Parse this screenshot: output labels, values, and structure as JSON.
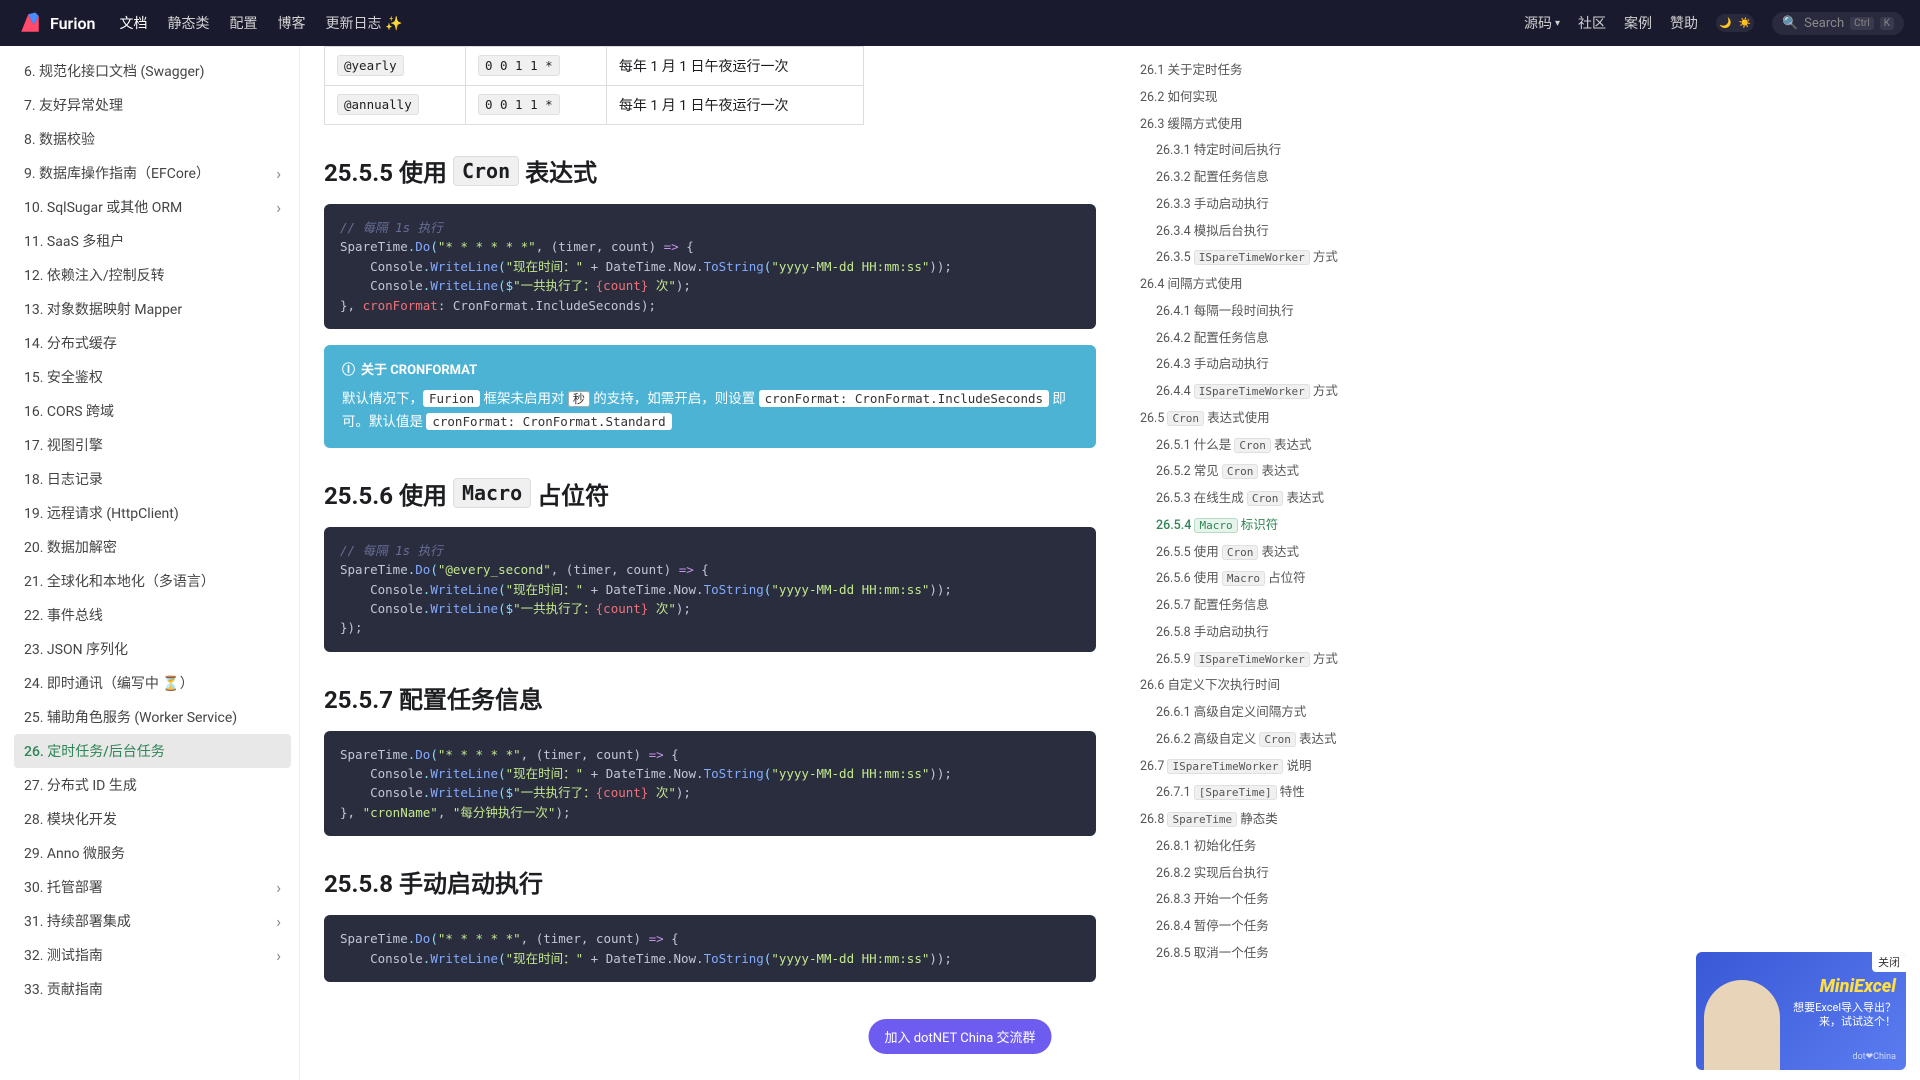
{
  "navbar": {
    "brand": "Furion",
    "links": [
      "文档",
      "静态类",
      "配置",
      "博客",
      "更新日志 ✨"
    ],
    "right": [
      "源码",
      "社区",
      "案例",
      "赞助"
    ],
    "search_placeholder": "Search",
    "kbd1": "Ctrl",
    "kbd2": "K"
  },
  "sidebar": [
    {
      "t": "6. 规范化接口文档 (Swagger)",
      "exp": false
    },
    {
      "t": "7. 友好异常处理",
      "exp": false
    },
    {
      "t": "8. 数据校验",
      "exp": false
    },
    {
      "t": "9. 数据库操作指南（EFCore）",
      "exp": true
    },
    {
      "t": "10. SqlSugar 或其他 ORM",
      "exp": true
    },
    {
      "t": "11. SaaS 多租户",
      "exp": false
    },
    {
      "t": "12. 依赖注入/控制反转",
      "exp": false
    },
    {
      "t": "13. 对象数据映射 Mapper",
      "exp": false
    },
    {
      "t": "14. 分布式缓存",
      "exp": false
    },
    {
      "t": "15. 安全鉴权",
      "exp": false
    },
    {
      "t": "16. CORS 跨域",
      "exp": false
    },
    {
      "t": "17. 视图引擎",
      "exp": false
    },
    {
      "t": "18. 日志记录",
      "exp": false
    },
    {
      "t": "19. 远程请求 (HttpClient)",
      "exp": false
    },
    {
      "t": "20. 数据加解密",
      "exp": false
    },
    {
      "t": "21. 全球化和本地化（多语言）",
      "exp": false
    },
    {
      "t": "22. 事件总线",
      "exp": false
    },
    {
      "t": "23. JSON 序列化",
      "exp": false
    },
    {
      "t": "24. 即时通讯（编写中 ⏳）",
      "exp": false
    },
    {
      "t": "25. 辅助角色服务 (Worker Service)",
      "exp": false
    },
    {
      "t": "26. 定时任务/后台任务",
      "exp": false,
      "active": true
    },
    {
      "t": "27. 分布式 ID 生成",
      "exp": false
    },
    {
      "t": "28. 模块化开发",
      "exp": false
    },
    {
      "t": "29. Anno 微服务",
      "exp": false
    },
    {
      "t": "30. 托管部署",
      "exp": true
    },
    {
      "t": "31. 持续部署集成",
      "exp": true
    },
    {
      "t": "32. 测试指南",
      "exp": true
    },
    {
      "t": "33. 贡献指南",
      "exp": false
    }
  ],
  "table_rows": [
    {
      "c0": "@yearly",
      "c1": "0 0 1 1 *",
      "c2": "每年 1 月 1 日午夜运行一次"
    },
    {
      "c0": "@annually",
      "c1": "0 0 1 1 *",
      "c2": "每年 1 月 1 日午夜运行一次"
    }
  ],
  "sections": {
    "s5": {
      "pre": "25.5.5 使用 ",
      "code": "Cron",
      "post": " 表达式"
    },
    "s6": {
      "pre": "25.5.6 使用 ",
      "code": "Macro",
      "post": " 占位符"
    },
    "s7": {
      "title": "25.5.7 配置任务信息"
    },
    "s8": {
      "title": "25.5.8 手动启动执行"
    }
  },
  "code1": {
    "l1": "// 每隔 1s 执行",
    "l2a": "SpareTime",
    "l2b": ".",
    "l2c": "Do",
    "l2d": "(",
    "l2e": "\"* * * * * *\"",
    "l2f": ", (timer, count) ",
    "l2g": "=>",
    "l2h": " {",
    "l3a": "    Console",
    "l3b": ".",
    "l3c": "WriteLine",
    "l3d": "(",
    "l3e": "\"现在时间：\"",
    "l3f": " + DateTime.Now.",
    "l3g": "ToString",
    "l3h": "(",
    "l3i": "\"yyyy-MM-dd HH:mm:ss\"",
    "l3j": "));",
    "l4a": "    Console",
    "l4b": ".",
    "l4c": "WriteLine",
    "l4d": "($",
    "l4e": "\"一共执行了：",
    "l4f": "{count}",
    "l4g": " 次\"",
    "l4h": ");",
    "l5a": "}, ",
    "l5b": "cronFormat",
    "l5c": ": CronFormat.IncludeSeconds);"
  },
  "admon": {
    "title": "关于 CRONFORMAT",
    "p1": "默认情况下，",
    "p2": "Furion",
    "p3": " 框架未启用对 ",
    "p4": "秒",
    "p5": " 的支持，如需开启，则设置 ",
    "p6": "cronFormat: CronFormat.IncludeSeconds",
    "p7": " 即可。默认值是 ",
    "p8": "cronFormat: CronFormat.Standard"
  },
  "code2": {
    "l1": "// 每隔 1s 执行",
    "l2a": "SpareTime",
    "l2b": ".",
    "l2c": "Do",
    "l2d": "(",
    "l2e": "\"@every_second\"",
    "l2f": ", (timer, count) ",
    "l2g": "=>",
    "l2h": " {",
    "l3a": "    Console",
    "l3b": ".",
    "l3c": "WriteLine",
    "l3d": "(",
    "l3e": "\"现在时间：\"",
    "l3f": " + DateTime.Now.",
    "l3g": "ToString",
    "l3h": "(",
    "l3i": "\"yyyy-MM-dd HH:mm:ss\"",
    "l3j": "));",
    "l4a": "    Console",
    "l4b": ".",
    "l4c": "WriteLine",
    "l4d": "($",
    "l4e": "\"一共执行了：",
    "l4f": "{count}",
    "l4g": " 次\"",
    "l4h": ");",
    "l5": "});"
  },
  "code3": {
    "l1a": "SpareTime",
    "l1b": ".",
    "l1c": "Do",
    "l1d": "(",
    "l1e": "\"* * * * *\"",
    "l1f": ", (timer, count) ",
    "l1g": "=>",
    "l1h": " {",
    "l2a": "    Console",
    "l2b": ".",
    "l2c": "WriteLine",
    "l2d": "(",
    "l2e": "\"现在时间：\"",
    "l2f": " + DateTime.Now.",
    "l2g": "ToString",
    "l2h": "(",
    "l2i": "\"yyyy-MM-dd HH:mm:ss\"",
    "l2j": "));",
    "l3a": "    Console",
    "l3b": ".",
    "l3c": "WriteLine",
    "l3d": "($",
    "l3e": "\"一共执行了：",
    "l3f": "{count}",
    "l3g": " 次\"",
    "l3h": ");",
    "l4a": "}, ",
    "l4b": "\"cronName\"",
    "l4c": ", ",
    "l4d": "\"每分钟执行一次\"",
    "l4e": ");"
  },
  "code4": {
    "l1a": "SpareTime",
    "l1b": ".",
    "l1c": "Do",
    "l1d": "(",
    "l1e": "\"* * * * *\"",
    "l1f": ", (timer, count) ",
    "l1g": "=>",
    "l1h": " {",
    "l2a": "    Console",
    "l2b": ".",
    "l2c": "WriteLine",
    "l2d": "(",
    "l2e": "\"现在时间：\"",
    "l2f": " + DateTime.Now.",
    "l2g": "ToString",
    "l2h": "(",
    "l2i": "\"yyyy-MM-dd HH:mm:ss\"",
    "l2j": "));"
  },
  "toc": [
    {
      "lvl": 1,
      "t": "26.1 关于定时任务"
    },
    {
      "lvl": 1,
      "t": "26.2 如何实现"
    },
    {
      "lvl": 1,
      "t": "26.3 缓隔方式使用"
    },
    {
      "lvl": 2,
      "t": "26.3.1 特定时间后执行"
    },
    {
      "lvl": 2,
      "t": "26.3.2 配置任务信息"
    },
    {
      "lvl": 2,
      "t": "26.3.3 手动启动执行"
    },
    {
      "lvl": 2,
      "t": "26.3.4 模拟后台执行"
    },
    {
      "lvl": 2,
      "pre": "26.3.5 ",
      "code": "ISpareTimeWorker",
      "post": " 方式"
    },
    {
      "lvl": 1,
      "t": "26.4 间隔方式使用"
    },
    {
      "lvl": 2,
      "t": "26.4.1 每隔一段时间执行"
    },
    {
      "lvl": 2,
      "t": "26.4.2 配置任务信息"
    },
    {
      "lvl": 2,
      "t": "26.4.3 手动启动执行"
    },
    {
      "lvl": 2,
      "pre": "26.4.4 ",
      "code": "ISpareTimeWorker",
      "post": " 方式"
    },
    {
      "lvl": 1,
      "pre": "26.5 ",
      "code": "Cron",
      "post": " 表达式使用"
    },
    {
      "lvl": 2,
      "pre": "26.5.1 什么是 ",
      "code": "Cron",
      "post": " 表达式"
    },
    {
      "lvl": 2,
      "pre": "26.5.2 常见 ",
      "code": "Cron",
      "post": " 表达式"
    },
    {
      "lvl": 2,
      "pre": "26.5.3 在线生成 ",
      "code": "Cron",
      "post": " 表达式"
    },
    {
      "lvl": 2,
      "pre": "26.5.4 ",
      "code": "Macro",
      "post": " 标识符",
      "active": true
    },
    {
      "lvl": 2,
      "pre": "26.5.5 使用 ",
      "code": "Cron",
      "post": " 表达式"
    },
    {
      "lvl": 2,
      "pre": "26.5.6 使用 ",
      "code": "Macro",
      "post": " 占位符"
    },
    {
      "lvl": 2,
      "t": "26.5.7 配置任务信息"
    },
    {
      "lvl": 2,
      "t": "26.5.8 手动启动执行"
    },
    {
      "lvl": 2,
      "pre": "26.5.9 ",
      "code": "ISpareTimeWorker",
      "post": " 方式"
    },
    {
      "lvl": 1,
      "t": "26.6 自定义下次执行时间"
    },
    {
      "lvl": 2,
      "t": "26.6.1 高级自定义间隔方式"
    },
    {
      "lvl": 2,
      "pre": "26.6.2 高级自定义 ",
      "code": "Cron",
      "post": " 表达式"
    },
    {
      "lvl": 1,
      "pre": "26.7 ",
      "code": "ISpareTimeWorker",
      "post": " 说明"
    },
    {
      "lvl": 2,
      "pre": "26.7.1 ",
      "code": "[SpareTime]",
      "post": " 特性"
    },
    {
      "lvl": 1,
      "pre": "26.8 ",
      "code": "SpareTime",
      "post": " 静态类"
    },
    {
      "lvl": 2,
      "t": "26.8.1 初始化任务"
    },
    {
      "lvl": 2,
      "t": "26.8.2 实现后台执行"
    },
    {
      "lvl": 2,
      "t": "26.8.3 开始一个任务"
    },
    {
      "lvl": 2,
      "t": "26.8.4 暂停一个任务"
    },
    {
      "lvl": 2,
      "t": "26.8.5 取消一个任务"
    }
  ],
  "float_btn": "加入 dotNET China 交流群",
  "promo": {
    "close": "关闭",
    "title": "MiniExcel",
    "sub1": "想要Excel导入导出？",
    "sub2": "来，试试这个！",
    "tag": "dot❤China"
  }
}
